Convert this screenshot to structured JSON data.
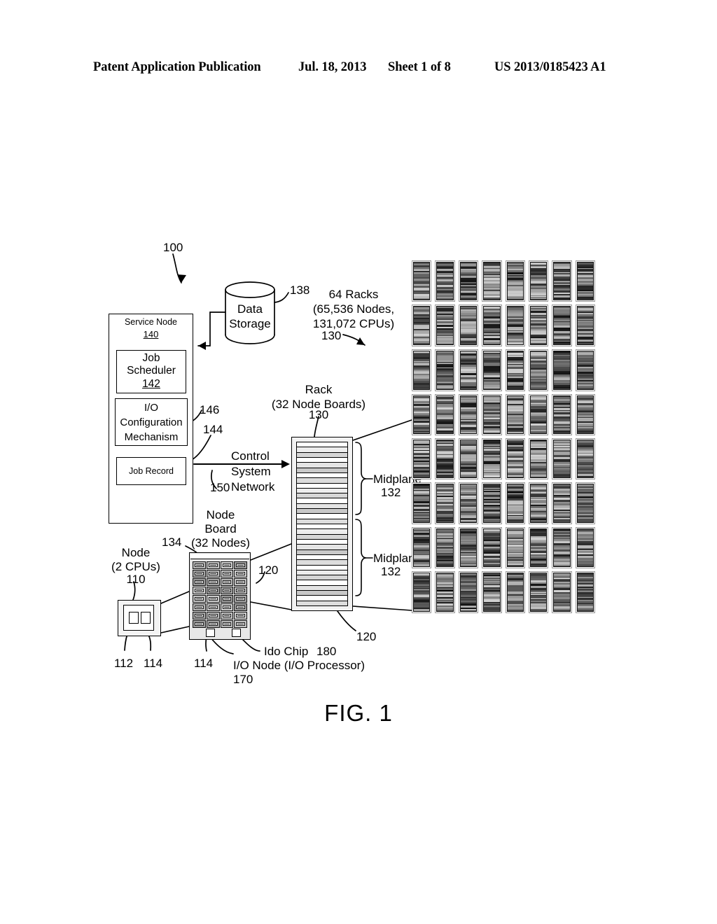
{
  "header": {
    "publication": "Patent Application Publication",
    "date": "Jul. 18, 2013",
    "sheet": "Sheet 1 of 8",
    "patent_number": "US 2013/0185423 A1"
  },
  "figure": {
    "caption": "FIG. 1",
    "system_ref": "100",
    "service_node": {
      "title": "Service Node",
      "ref": "140",
      "job_scheduler": {
        "line1": "Job",
        "line2": "Scheduler",
        "ref": "142"
      },
      "io_config": {
        "line1": "I/O",
        "line2": "Configuration",
        "line3": "Mechanism",
        "ref": "146"
      },
      "job_record": {
        "label": "Job Record",
        "ref": "144"
      }
    },
    "data_storage": {
      "line1": "Data",
      "line2": "Storage",
      "ref": "138"
    },
    "racks_summary": {
      "line1": "64 Racks",
      "line2": "(65,536 Nodes,",
      "line3": "131,072 CPUs)",
      "ref": "130"
    },
    "control_network": {
      "line1": "Control",
      "line2": "System",
      "line3": "Network",
      "ref": "150"
    },
    "rack": {
      "line1": "Rack",
      "line2": "(32 Node Boards)",
      "ref": "130"
    },
    "midplane_upper": {
      "label": "Midplane",
      "ref": "132"
    },
    "midplane_lower": {
      "label": "Midplane",
      "ref": "132"
    },
    "node_board": {
      "line1": "Node",
      "line2": "Board",
      "line3": "(32 Nodes)",
      "ref": "134"
    },
    "node": {
      "line1": "Node",
      "line2": "(2 CPUs)",
      "ref": "110"
    },
    "node_parts": {
      "cpu_ref": "112",
      "chip_ref": "114"
    },
    "node_board_chip_ref": "114",
    "node_board_link_ref": "120",
    "rack_slot_link_ref": "120",
    "ido_chip": {
      "label": "Ido Chip",
      "ref": "180"
    },
    "io_node": {
      "label": "I/O Node (I/O Processor)",
      "ref": "170"
    },
    "counts": {
      "rack_array_columns": 8,
      "rack_array_rows": 8,
      "rack_array_total": 64,
      "node_board_chip_columns": 4,
      "node_board_chip_rows": 8,
      "node_board_chip_total": 32,
      "rack_slats": 32,
      "cpus_per_node": 2
    },
    "colors": {
      "ink": "#000000",
      "paper": "#ffffff",
      "rack_fill": "#4a4a4a",
      "chip_fill": "#bdbdbd"
    }
  }
}
